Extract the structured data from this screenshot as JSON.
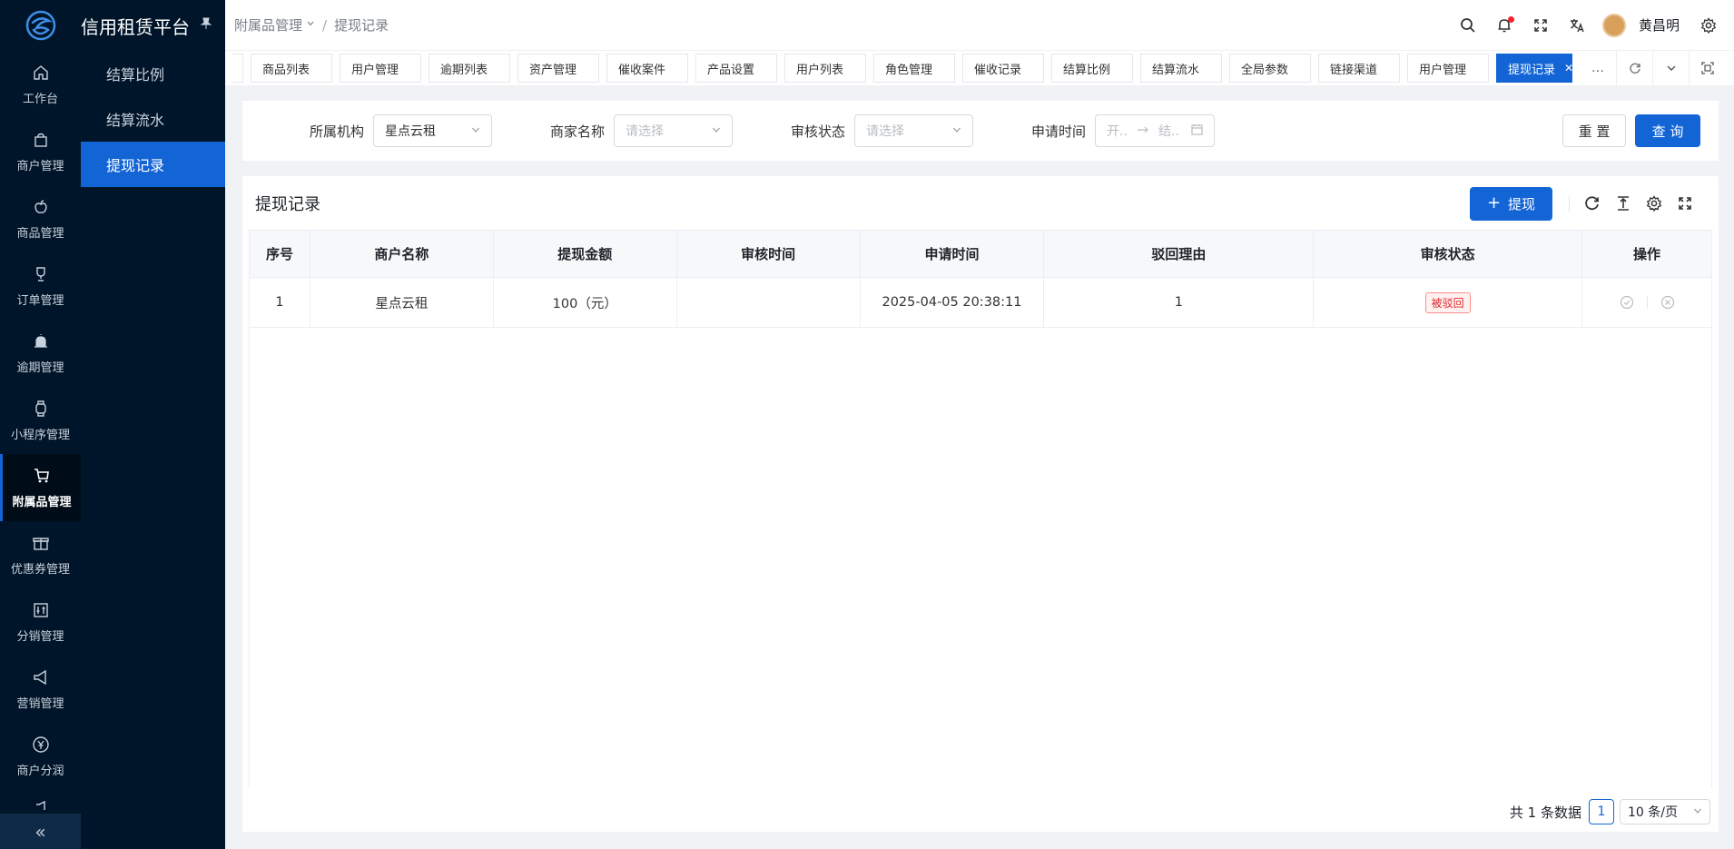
{
  "app": {
    "title": "信用租赁平台"
  },
  "rail": {
    "items": [
      {
        "label": "工作台",
        "icon": "home-icon"
      },
      {
        "label": "商户管理",
        "icon": "bag-icon"
      },
      {
        "label": "商品管理",
        "icon": "apple-icon"
      },
      {
        "label": "订单管理",
        "icon": "trophy-icon"
      },
      {
        "label": "逾期管理",
        "icon": "alarm-icon"
      },
      {
        "label": "小程序管理",
        "icon": "watch-icon"
      },
      {
        "label": "附属品管理",
        "icon": "cart-icon",
        "active": true
      },
      {
        "label": "优惠券管理",
        "icon": "gift-icon"
      },
      {
        "label": "分销管理",
        "icon": "sliders-icon"
      },
      {
        "label": "营销管理",
        "icon": "megaphone-icon"
      },
      {
        "label": "商户分润",
        "icon": "yen-icon"
      }
    ],
    "collapse_glyph": "«"
  },
  "submenu": {
    "items": [
      {
        "label": "结算比例"
      },
      {
        "label": "结算流水"
      },
      {
        "label": "提现记录",
        "active": true
      }
    ]
  },
  "header": {
    "breadcrumb": {
      "parent": "附属品管理",
      "current": "提现记录"
    },
    "user_name": "黄昌明"
  },
  "tabs": {
    "items": [
      "商品列表",
      "用户管理",
      "逾期列表",
      "资产管理",
      "催收案件",
      "产品设置",
      "用户列表",
      "角色管理",
      "催收记录",
      "结算比例",
      "结算流水",
      "全局参数",
      "链接渠道",
      "用户管理"
    ],
    "active": "提现记录",
    "more": "…"
  },
  "filter": {
    "org_label": "所属机构",
    "org_value": "星点云租",
    "merchant_label": "商家名称",
    "merchant_placeholder": "请选择",
    "status_label": "审核状态",
    "status_placeholder": "请选择",
    "time_label": "申请时间",
    "date_start_placeholder": "开..",
    "date_end_placeholder": "结..",
    "reset_label": "重 置",
    "search_label": "查 询"
  },
  "card": {
    "title": "提现记录",
    "withdraw_label": "提现"
  },
  "table": {
    "columns": [
      "序号",
      "商户名称",
      "提现金额",
      "审核时间",
      "申请时间",
      "驳回理由",
      "审核状态",
      "操作"
    ],
    "rows": [
      {
        "index": "1",
        "merchant": "星点云租",
        "amount": "100（元）",
        "review_time": "",
        "apply_time": "2025-04-05 20:38:11",
        "reject_reason": "1",
        "status": "被驳回"
      }
    ]
  },
  "pagination": {
    "total_text": "共 1 条数据",
    "current_page": "1",
    "page_size": "10 条/页"
  },
  "colors": {
    "primary": "#1365d6",
    "sidebar": "#001529",
    "danger": "#e0282e"
  }
}
